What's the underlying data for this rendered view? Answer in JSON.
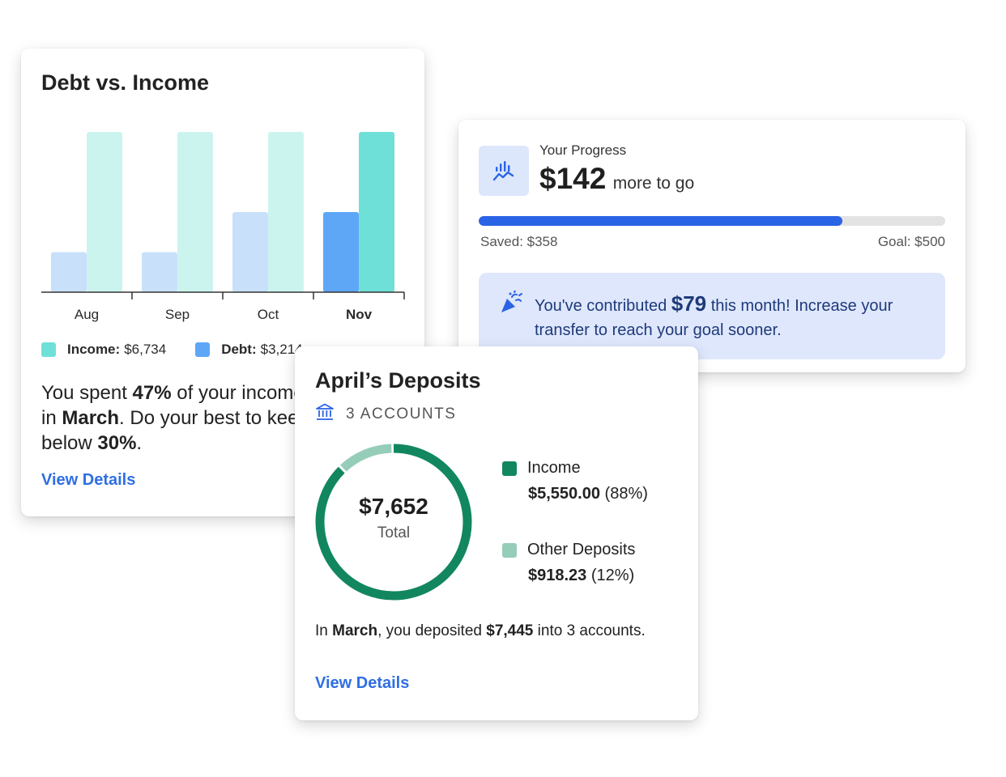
{
  "debt_card": {
    "title": "Debt vs. Income",
    "legend": {
      "income_label": "Income:",
      "income_value": "$6,734",
      "debt_label": "Debt:",
      "debt_value": "$3,214",
      "income_color": "#6fe0d8",
      "debt_color": "#5ea7f7"
    },
    "summary": {
      "p1": "You spent ",
      "pct": "47%",
      "p2": " of your income",
      "p3": "in ",
      "month": "March",
      "p4": ". Do your best to keep it",
      "p5": "below ",
      "target": "30%",
      "p6": "."
    },
    "link": "View Details"
  },
  "chart_data": {
    "type": "bar",
    "categories": [
      "Aug",
      "Sep",
      "Oct",
      "Nov"
    ],
    "highlighted_category": "Nov",
    "series": [
      {
        "name": "Debt",
        "values": [
          1,
          1,
          2,
          2
        ],
        "color": "#c9e0fb",
        "highlight_color": "#5ea7f7"
      },
      {
        "name": "Income",
        "values": [
          4,
          4,
          4,
          4
        ],
        "color": "#ccf4ef",
        "highlight_color": "#6fe0d8"
      }
    ],
    "ylim": [
      0,
      4
    ],
    "grid": false,
    "legend": "bottom"
  },
  "progress_card": {
    "label": "Your Progress",
    "amount": "$142",
    "amount_suffix": "more to go",
    "saved": "Saved: $358",
    "goal": "Goal: $500",
    "progress_fraction": 0.78,
    "icon": "chart-trend-icon",
    "callout": {
      "icon": "party-popper-icon",
      "t1": "You've contributed ",
      "amount": "$79",
      "t2": " this month! Increase your transfer to reach your goal sooner."
    }
  },
  "deposits_card": {
    "title": "April’s Deposits",
    "accounts": "3 ACCOUNTS",
    "accounts_icon": "bank-icon",
    "total": "$7,652",
    "total_label": "Total",
    "slices": [
      {
        "name": "Income",
        "amount": "$5,550.00",
        "pct": "(88%)",
        "fraction": 0.88,
        "color": "#12875f"
      },
      {
        "name": "Other Deposits",
        "amount": "$918.23",
        "pct": "(12%)",
        "fraction": 0.12,
        "color": "#96cdb9"
      }
    ],
    "text": {
      "t1": "In ",
      "month": "March",
      "t2": ", you deposited ",
      "amount": "$7,445",
      "t3": " into 3 accounts."
    },
    "link": "View Details"
  }
}
